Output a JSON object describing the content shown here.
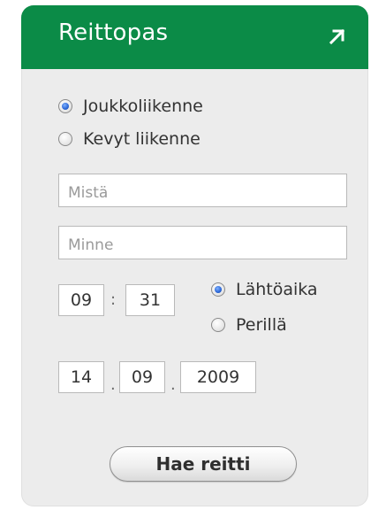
{
  "header": {
    "title": "Reittopas",
    "arrow_icon": "external-arrow-icon"
  },
  "mode": {
    "options": [
      {
        "label": "Joukkoliikenne",
        "selected": true
      },
      {
        "label": "Kevyt liikenne",
        "selected": false
      }
    ]
  },
  "route": {
    "from_placeholder": "Mistä",
    "to_placeholder": "Minne"
  },
  "time": {
    "hour": "09",
    "minute": "31",
    "separator": ":",
    "options": [
      {
        "label": "Lähtöaika",
        "selected": true
      },
      {
        "label": "Perillä",
        "selected": false
      }
    ]
  },
  "date": {
    "day": "14",
    "month": "09",
    "year": "2009",
    "separator": "."
  },
  "submit_label": "Hae reitti",
  "colors": {
    "header_bg": "#0b8b47",
    "panel_bg": "#ececec"
  }
}
